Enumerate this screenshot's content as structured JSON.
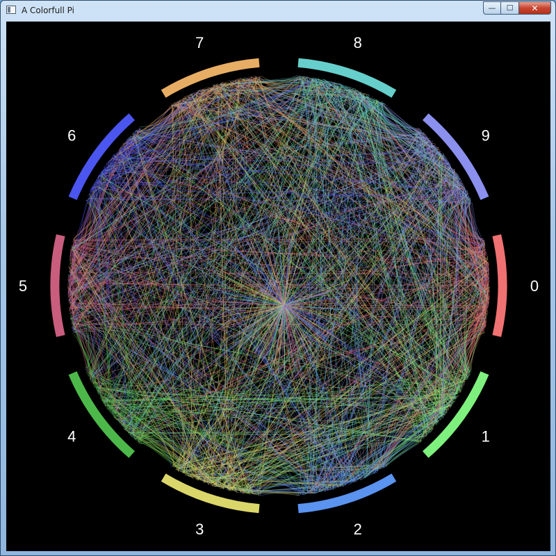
{
  "window": {
    "title": "A Colorfull Pi",
    "controls": {
      "minimize": "—",
      "maximize": "☐",
      "close": "✕"
    }
  },
  "visualization": {
    "segments": [
      {
        "digit": "0",
        "color": "#f07171"
      },
      {
        "digit": "1",
        "color": "#7ef07e"
      },
      {
        "digit": "2",
        "color": "#5a93f0"
      },
      {
        "digit": "3",
        "color": "#dbd66a"
      },
      {
        "digit": "4",
        "color": "#4db84a"
      },
      {
        "digit": "5",
        "color": "#c95d7e"
      },
      {
        "digit": "6",
        "color": "#4b55f0"
      },
      {
        "digit": "7",
        "color": "#e8ad64"
      },
      {
        "digit": "8",
        "color": "#66cfcb"
      },
      {
        "digit": "9",
        "color": "#8b90ee"
      }
    ]
  }
}
